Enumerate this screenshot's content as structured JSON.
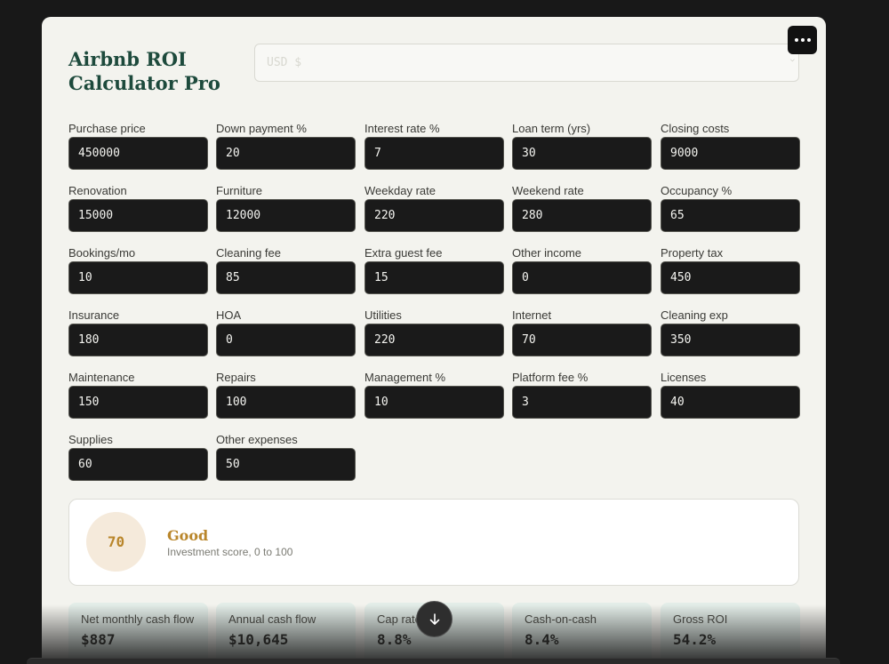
{
  "app": {
    "title": "Airbnb ROI Calculator Pro"
  },
  "currency": {
    "placeholder": "USD $"
  },
  "fields": [
    {
      "label": "Purchase price",
      "value": "450000"
    },
    {
      "label": "Down payment %",
      "value": "20"
    },
    {
      "label": "Interest rate %",
      "value": "7"
    },
    {
      "label": "Loan term (yrs)",
      "value": "30"
    },
    {
      "label": "Closing costs",
      "value": "9000"
    },
    {
      "label": "Renovation",
      "value": "15000"
    },
    {
      "label": "Furniture",
      "value": "12000"
    },
    {
      "label": "Weekday rate",
      "value": "220"
    },
    {
      "label": "Weekend rate",
      "value": "280"
    },
    {
      "label": "Occupancy %",
      "value": "65"
    },
    {
      "label": "Bookings/mo",
      "value": "10"
    },
    {
      "label": "Cleaning fee",
      "value": "85"
    },
    {
      "label": "Extra guest fee",
      "value": "15"
    },
    {
      "label": "Other income",
      "value": "0"
    },
    {
      "label": "Property tax",
      "value": "450"
    },
    {
      "label": "Insurance",
      "value": "180"
    },
    {
      "label": "HOA",
      "value": "0"
    },
    {
      "label": "Utilities",
      "value": "220"
    },
    {
      "label": "Internet",
      "value": "70"
    },
    {
      "label": "Cleaning exp",
      "value": "350"
    },
    {
      "label": "Maintenance",
      "value": "150"
    },
    {
      "label": "Repairs",
      "value": "100"
    },
    {
      "label": "Management %",
      "value": "10"
    },
    {
      "label": "Platform fee %",
      "value": "3"
    },
    {
      "label": "Licenses",
      "value": "40"
    },
    {
      "label": "Supplies",
      "value": "60"
    },
    {
      "label": "Other expenses",
      "value": "50"
    }
  ],
  "score": {
    "value": "70",
    "rating": "Good",
    "caption": "Investment score, 0 to 100"
  },
  "metrics": [
    {
      "label": "Net monthly cash flow",
      "value": "$887"
    },
    {
      "label": "Annual cash flow",
      "value": "$10,645"
    },
    {
      "label": "Cap rate",
      "value": "8.8%"
    },
    {
      "label": "Cash-on-cash",
      "value": "8.4%"
    },
    {
      "label": "Gross ROI",
      "value": "54.2%"
    }
  ],
  "icons": {
    "menu": "more-horizontal-icon",
    "scroll": "arrow-down-icon",
    "currency_chevron": "chevron-down-icon"
  }
}
